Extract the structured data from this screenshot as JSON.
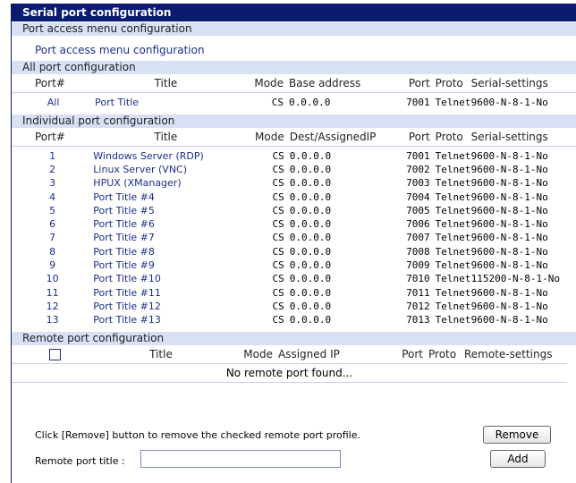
{
  "panel": {
    "title": "Serial port configuration"
  },
  "access": {
    "section": "Port access menu configuration",
    "link": "Port access menu configuration"
  },
  "all_port": {
    "section": "All port configuration",
    "headers": {
      "port": "Port#",
      "title": "Title",
      "mode": "Mode",
      "addr": "Base address",
      "pnum": "Port",
      "proto": "Proto",
      "serial": "Serial-settings"
    },
    "row": {
      "port": "All",
      "title": "Port Title",
      "mode": "CS",
      "addr": "0.0.0.0",
      "pnum": "7001",
      "proto": "Telnet",
      "serial": "9600-N-8-1-No"
    }
  },
  "individual": {
    "section": "Individual port configuration",
    "headers": {
      "port": "Port#",
      "title": "Title",
      "mode": "Mode",
      "addr": "Dest/AssignedIP",
      "pnum": "Port",
      "proto": "Proto",
      "serial": "Serial-settings"
    },
    "rows": [
      {
        "port": "1",
        "title": "Windows Server (RDP)",
        "mode": "CS",
        "addr": "0.0.0.0",
        "pnum": "7001",
        "proto": "Telnet",
        "serial": "9600-N-8-1-No"
      },
      {
        "port": "2",
        "title": "Linux Server (VNC)",
        "mode": "CS",
        "addr": "0.0.0.0",
        "pnum": "7002",
        "proto": "Telnet",
        "serial": "9600-N-8-1-No"
      },
      {
        "port": "3",
        "title": "HPUX (XManager)",
        "mode": "CS",
        "addr": "0.0.0.0",
        "pnum": "7003",
        "proto": "Telnet",
        "serial": "9600-N-8-1-No"
      },
      {
        "port": "4",
        "title": "Port Title #4",
        "mode": "CS",
        "addr": "0.0.0.0",
        "pnum": "7004",
        "proto": "Telnet",
        "serial": "9600-N-8-1-No"
      },
      {
        "port": "5",
        "title": "Port Title #5",
        "mode": "CS",
        "addr": "0.0.0.0",
        "pnum": "7005",
        "proto": "Telnet",
        "serial": "9600-N-8-1-No"
      },
      {
        "port": "6",
        "title": "Port Title #6",
        "mode": "CS",
        "addr": "0.0.0.0",
        "pnum": "7006",
        "proto": "Telnet",
        "serial": "9600-N-8-1-No"
      },
      {
        "port": "7",
        "title": "Port Title #7",
        "mode": "CS",
        "addr": "0.0.0.0",
        "pnum": "7007",
        "proto": "Telnet",
        "serial": "9600-N-8-1-No"
      },
      {
        "port": "8",
        "title": "Port Title #8",
        "mode": "CS",
        "addr": "0.0.0.0",
        "pnum": "7008",
        "proto": "Telnet",
        "serial": "9600-N-8-1-No"
      },
      {
        "port": "9",
        "title": "Port Title #9",
        "mode": "CS",
        "addr": "0.0.0.0",
        "pnum": "7009",
        "proto": "Telnet",
        "serial": "9600-N-8-1-No"
      },
      {
        "port": "10",
        "title": "Port Title #10",
        "mode": "CS",
        "addr": "0.0.0.0",
        "pnum": "7010",
        "proto": "Telnet",
        "serial": "115200-N-8-1-No"
      },
      {
        "port": "11",
        "title": "Port Title #11",
        "mode": "CS",
        "addr": "0.0.0.0",
        "pnum": "7011",
        "proto": "Telnet",
        "serial": "9600-N-8-1-No"
      },
      {
        "port": "12",
        "title": "Port Title #12",
        "mode": "CS",
        "addr": "0.0.0.0",
        "pnum": "7012",
        "proto": "Telnet",
        "serial": "9600-N-8-1-No"
      },
      {
        "port": "13",
        "title": "Port Title #13",
        "mode": "CS",
        "addr": "0.0.0.0",
        "pnum": "7013",
        "proto": "Telnet",
        "serial": "9600-N-8-1-No"
      }
    ]
  },
  "remote": {
    "section": "Remote port configuration",
    "headers": {
      "title": "Title",
      "mode": "Mode",
      "addr": "Assigned IP",
      "pnum": "Port",
      "proto": "Proto",
      "settings": "Remote-settings"
    },
    "empty_message": "No remote port found...",
    "instruction": "Click [Remove] button to remove the checked remote port profile.",
    "remove_label": "Remove",
    "title_label": "Remote port title :",
    "title_value": "",
    "add_label": "Add"
  },
  "colors": {
    "title_bar": "#0a1a6e",
    "section_bar": "#d8e0f4",
    "link": "#1a2f8c"
  }
}
